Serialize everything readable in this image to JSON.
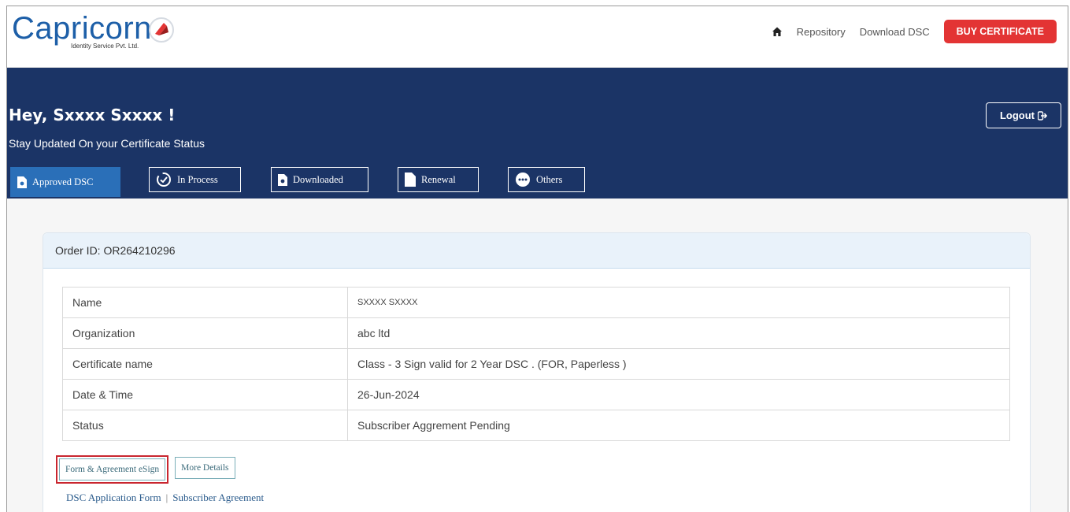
{
  "brand": {
    "name": "Capricorn",
    "tagline": "Identity Service Pvt. Ltd.",
    "color": "#1d5fa8"
  },
  "nav": {
    "home_icon": "home-icon",
    "repository": "Repository",
    "download_dsc": "Download DSC",
    "buy_certificate": "BUY CERTIFICATE"
  },
  "banner": {
    "greeting": "Hey, Sxxxx  Sxxxx !",
    "subtext": "Stay Updated On your Certificate Status",
    "logout": "Logout"
  },
  "tabs": [
    {
      "label": "Approved DSC",
      "icon": "file-gear-icon",
      "active": true
    },
    {
      "label": "In Process",
      "icon": "progress-clock-icon",
      "active": false
    },
    {
      "label": "Downloaded",
      "icon": "file-gear-icon",
      "active": false
    },
    {
      "label": "Renewal",
      "icon": "file-icon",
      "active": false
    },
    {
      "label": "Others",
      "icon": "ellipsis-circle-icon",
      "active": false
    }
  ],
  "order": {
    "label": "Order ID: OR264210296"
  },
  "details": [
    {
      "key": "Name",
      "value": "SXXXX SXXXX"
    },
    {
      "key": "Organization",
      "value": "abc ltd"
    },
    {
      "key": "Certificate name",
      "value": "Class - 3 Sign valid for 2 Year DSC . (FOR, Paperless )"
    },
    {
      "key": "Date & Time",
      "value": "26-Jun-2024"
    },
    {
      "key": "Status",
      "value": "Subscriber Aggrement Pending"
    }
  ],
  "actions": {
    "esign": "Form & Agreement eSign",
    "more_details": "More Details"
  },
  "links": {
    "application_form": "DSC Application Form",
    "separator": "|",
    "subscriber_agreement": "Subscriber Agreement"
  },
  "colors": {
    "banner": "#1b3466",
    "active_tab": "#2a6fb8",
    "buy_button": "#e33434",
    "status_text": "#b8483e",
    "highlight": "#c9262f"
  }
}
